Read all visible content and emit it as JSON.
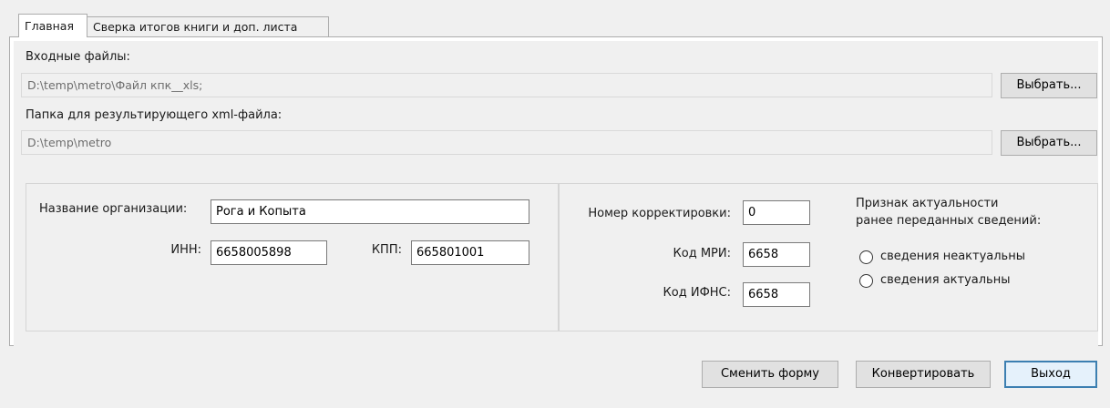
{
  "tabs": [
    {
      "label": "Главная",
      "active": true
    },
    {
      "label": "Сверка итогов книги и доп. листа",
      "active": false
    }
  ],
  "input_files": {
    "label": "Входные файлы:",
    "value": "D:\\temp\\metro\\Файл кпк__xls;",
    "browse_label": "Выбрать..."
  },
  "output_folder": {
    "label": "Папка для результирующего xml-файла:",
    "value": "D:\\temp\\metro",
    "browse_label": "Выбрать..."
  },
  "org": {
    "name_label": "Название организации:",
    "name_value": "Рога и Копыта",
    "inn_label": "ИНН:",
    "inn_value": "6658005898",
    "kpp_label": "КПП:",
    "kpp_value": "665801001"
  },
  "correction": {
    "number_label": "Номер корректировки:",
    "number_value": "0",
    "mri_label": "Код МРИ:",
    "mri_value": "6658",
    "ifns_label": "Код ИФНС:",
    "ifns_value": "6658",
    "relevance_label_line1": "Признак актуальности",
    "relevance_label_line2": "ранее переданных сведений:",
    "radio_options": [
      "сведения неактуальны",
      "сведения актуальны"
    ]
  },
  "footer": {
    "change_form_label": "Сменить форму",
    "convert_label": "Конвертировать",
    "exit_label": "Выход"
  },
  "colors": {
    "window_bg": "#f0f0f0",
    "tab_page_bg": "#ffffff",
    "default_button_border": "#3c7fb1"
  }
}
